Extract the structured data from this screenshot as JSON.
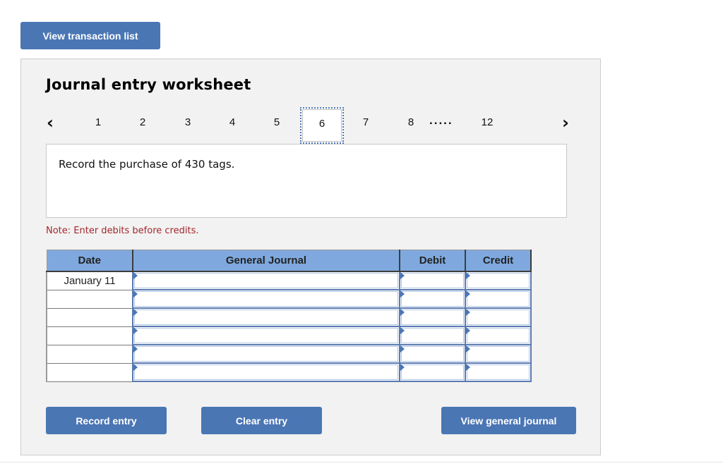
{
  "top_button": {
    "label": "View transaction list"
  },
  "worksheet": {
    "title": "Journal entry worksheet",
    "pager": {
      "prev_icon": "chevron-left-icon",
      "next_icon": "chevron-right-icon",
      "pages": [
        "1",
        "2",
        "3",
        "4",
        "5",
        "6",
        "7",
        "8"
      ],
      "ellipsis": ".....",
      "last_page": "12",
      "active_page": "6"
    },
    "question": "Record the purchase of 430 tags.",
    "note": "Note: Enter debits before credits.",
    "table": {
      "columns": [
        "Date",
        "General Journal",
        "Debit",
        "Credit"
      ],
      "rows": [
        {
          "date": "January 11",
          "account": "",
          "debit": "",
          "credit": ""
        },
        {
          "date": "",
          "account": "",
          "debit": "",
          "credit": ""
        },
        {
          "date": "",
          "account": "",
          "debit": "",
          "credit": ""
        },
        {
          "date": "",
          "account": "",
          "debit": "",
          "credit": ""
        },
        {
          "date": "",
          "account": "",
          "debit": "",
          "credit": ""
        },
        {
          "date": "",
          "account": "",
          "debit": "",
          "credit": ""
        }
      ]
    },
    "buttons": {
      "record": "Record entry",
      "clear": "Clear entry",
      "view_general_journal": "View general journal"
    }
  },
  "colors": {
    "button": "#4a76b4",
    "header": "#7fa9de",
    "note": "#a4262c",
    "panel": "#f2f2f2"
  }
}
